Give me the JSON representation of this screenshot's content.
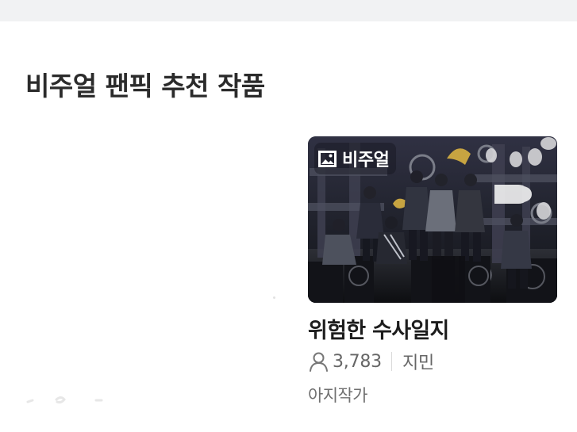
{
  "section": {
    "title": "비주얼 팬픽 추천 작품"
  },
  "card": {
    "badge": {
      "icon": "image-icon",
      "label": "비주얼"
    },
    "title": "위험한 수사일지",
    "views": "3,783",
    "views_icon": "person-icon",
    "character": "지민",
    "author": "아지작가"
  },
  "colors": {
    "title": "#2b2b2b",
    "meta": "#666666",
    "author": "#707070",
    "top_strip": "#f1f2f3"
  }
}
